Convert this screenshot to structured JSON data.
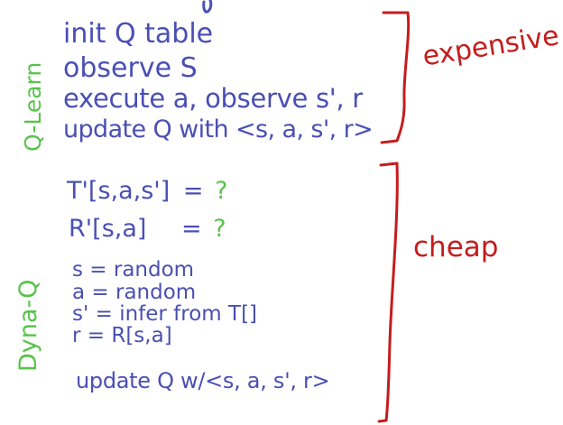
{
  "side_labels": {
    "qlearn": "Q-Learn",
    "dynaq": "Dyna-Q"
  },
  "qlearn_lines": [
    "init Q table",
    "observe S",
    "execute a, observe s', r",
    "update Q with <s, a, s', r>"
  ],
  "dyna_model": {
    "t_expr": "T'[s,a,s']",
    "t_eq": "=",
    "t_q": "?",
    "r_expr": "R'[s,a]",
    "r_eq": "=",
    "r_q": "?"
  },
  "dyna_lines": [
    "s = random",
    "a = random",
    "s' = infer from T[]",
    "r = R[s,a]"
  ],
  "dyna_update": "update Q w/<s, a, s', r>",
  "annotations": {
    "expensive": "expensive",
    "cheap": "cheap"
  },
  "colors": {
    "ink_blue": "#4a4fb3",
    "ink_green": "#58c34a",
    "ink_red": "#c51c1c"
  }
}
